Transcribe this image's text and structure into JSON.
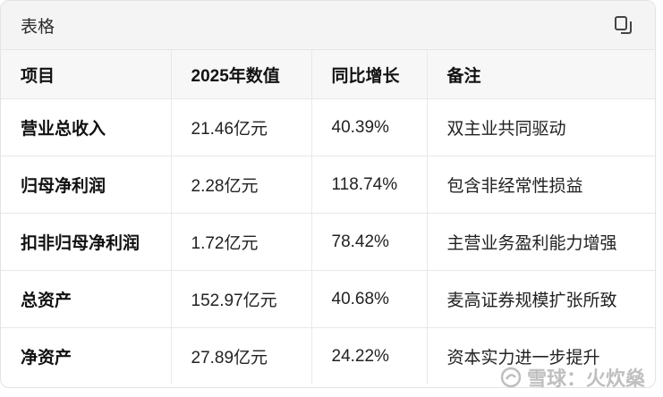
{
  "card": {
    "title": "表格",
    "copy_icon": "copy-icon"
  },
  "table": {
    "headers": [
      "项目",
      "2025年数值",
      "同比增长",
      "备注"
    ],
    "rows": [
      [
        "营业总收入",
        "21.46亿元",
        "40.39%",
        "双主业共同驱动"
      ],
      [
        "归母净利润",
        "2.28亿元",
        "118.74%",
        "包含非经常性损益"
      ],
      [
        "扣非归母净利润",
        "1.72亿元",
        "78.42%",
        "主营业务盈利能力增强"
      ],
      [
        "总资产",
        "152.97亿元",
        "40.68%",
        "麦高证券规模扩张所致"
      ],
      [
        "净资产",
        "27.89亿元",
        "24.22%",
        "资本实力进一步提升"
      ]
    ]
  },
  "watermark": {
    "text": "雪球：火炊燊",
    "icon": "snowball-logo-icon"
  }
}
